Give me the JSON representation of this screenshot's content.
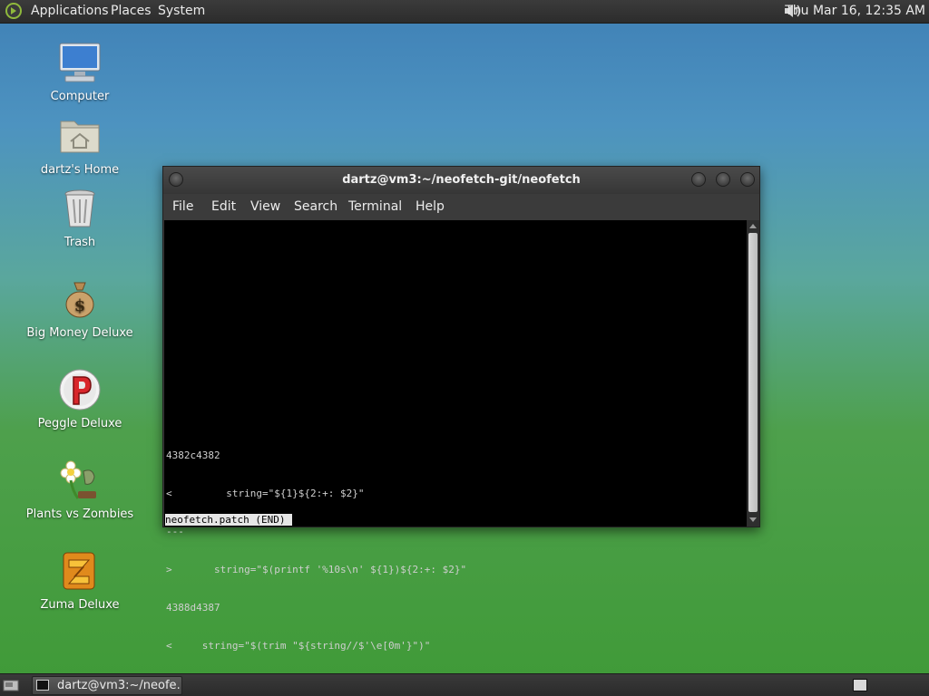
{
  "top_panel": {
    "menus": [
      "Applications",
      "Places",
      "System"
    ],
    "clock": "Thu Mar 16, 12:35 AM",
    "icons": {
      "logo": "gentoo-swirl-icon",
      "volume": "speaker-icon"
    }
  },
  "desktop": {
    "icons": [
      {
        "label": "Computer",
        "icon": "computer-icon"
      },
      {
        "label": "dartz's Home",
        "icon": "home-folder-icon"
      },
      {
        "label": "Trash",
        "icon": "trash-icon"
      },
      {
        "label": "Big Money Deluxe",
        "icon": "money-bag-icon"
      },
      {
        "label": "Peggle Deluxe",
        "icon": "peggle-icon"
      },
      {
        "label": "Plants vs Zombies",
        "icon": "plants-vs-zombies-icon"
      },
      {
        "label": "Zuma Deluxe",
        "icon": "zuma-icon"
      }
    ]
  },
  "terminal": {
    "title": "dartz@vm3:~/neofetch-git/neofetch",
    "menu": [
      "File",
      "Edit",
      "View",
      "Search",
      "Terminal",
      "Help"
    ],
    "lines": [
      "4382c4382",
      "<         string=\"${1}${2:+: $2}\"",
      "---",
      ">       string=\"$(printf '%10s\\n' ${1})${2:+: $2}\"",
      "4388d4387",
      "<     string=\"$(trim \"${string//$'\\e[0m'}\")\""
    ],
    "status": "neofetch.patch (END)"
  },
  "bottom_panel": {
    "task_label": "dartz@vm3:~/neofe…"
  },
  "colors": {
    "panel": "#2f2f2f",
    "terminal_bg": "#000000",
    "terminal_fg": "#cfcfcf",
    "desktop_top": "#3f80b6",
    "desktop_bottom": "#3f9a37"
  }
}
